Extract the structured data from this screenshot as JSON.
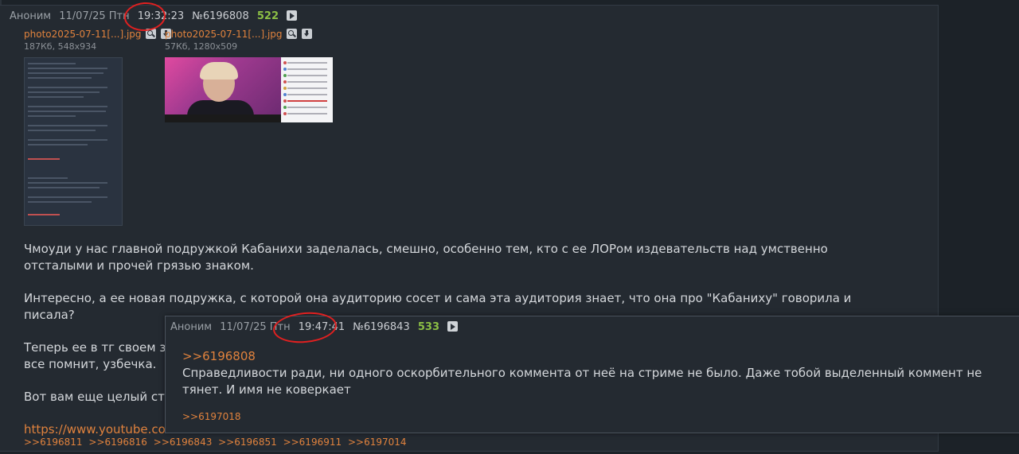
{
  "post": {
    "name": "Аноним",
    "date": "11/07/25 Птн",
    "time": "19:32:23",
    "number": "№6196808",
    "reply_count": "522",
    "files": [
      {
        "name": "photo2025-07-11[...].jpg",
        "meta": "187Кб, 548x934"
      },
      {
        "name": "photo2025-07-11[...].jpg",
        "meta": "57Кб, 1280x509"
      }
    ],
    "paragraphs": [
      "Чмоуди у нас главной подружкой Кабанихи заделалась, смешно, особенно тем, кто с ее ЛОРом издевательств над умственно отсталыми и прочей грязью знаком.",
      "Интересно, а ее новая подружка, с которой она аудиторию сосет и сама эта аудитория знает, что она про \"Кабаниху\" говорила и писала?",
      "Теперь ее в тг своем за",
      "все помнит, узбечка.",
      "Вот вам еще целый стри"
    ],
    "link": "https://www.youtube.co",
    "replies": [
      ">>6196811",
      ">>6196816",
      ">>6196843",
      ">>6196851",
      ">>6196911",
      ">>6197014"
    ]
  },
  "popup": {
    "name": "Аноним",
    "date": "11/07/25 Птн",
    "time": "19:47:41",
    "number": "№6196843",
    "reply_count": "533",
    "quote": ">>6196808",
    "text": "Справедливости ради, ни одного оскорбительного коммента от неё на стриме не было. Даже тобой выделенный коммент не тянет. И имя не коверкает",
    "reply": ">>6197018"
  }
}
